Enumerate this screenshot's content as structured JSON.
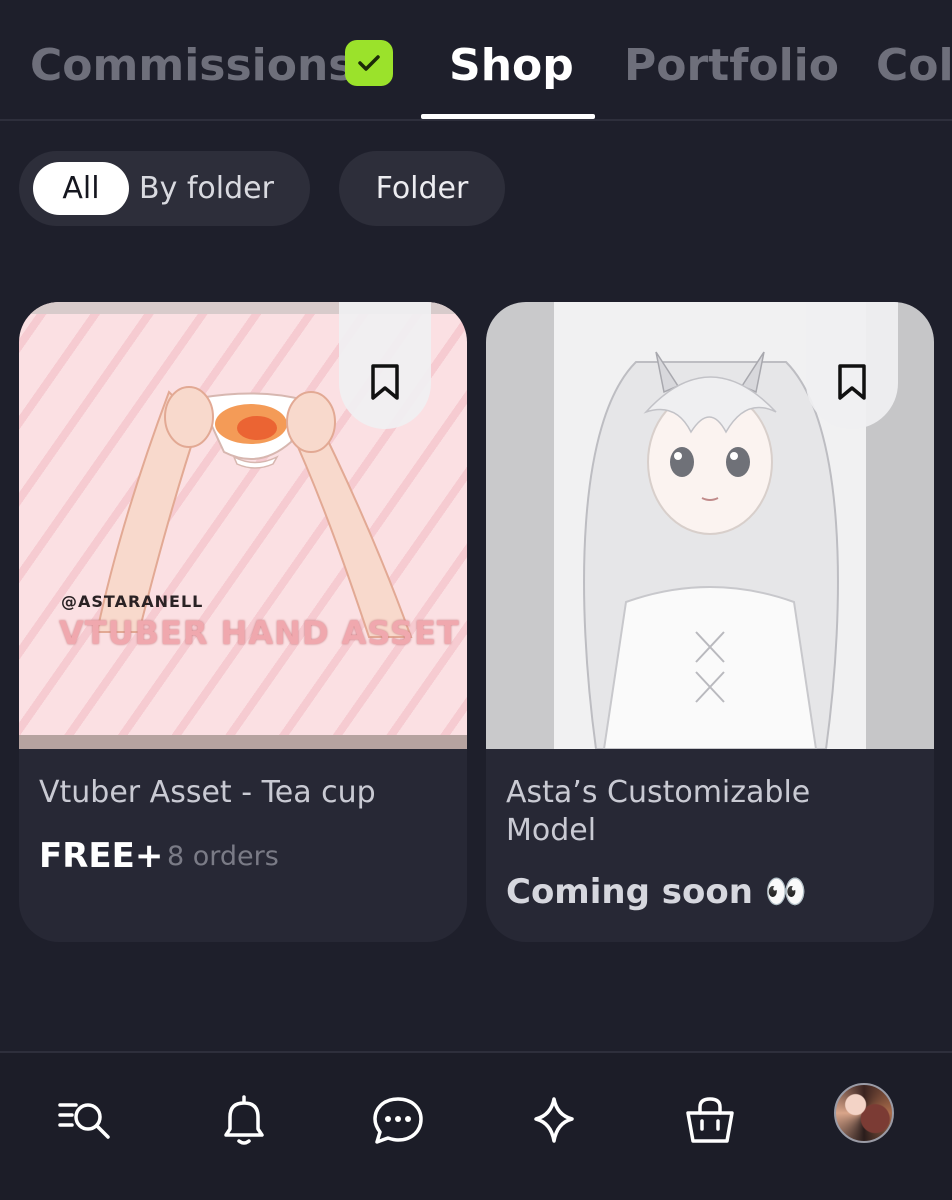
{
  "tabs": [
    {
      "label": "Commissions"
    },
    {
      "label": "Shop"
    },
    {
      "label": "Portfolio"
    },
    {
      "label": "Col"
    }
  ],
  "filters": {
    "all": "All",
    "by_folder": "By folder",
    "folder": "Folder"
  },
  "cards": [
    {
      "title": "Vtuber Asset - Tea cup",
      "price": "FREE+",
      "orders": "8 orders",
      "watermark_handle": "@ASTARANELL",
      "watermark_title": "VTUBER HAND ASSET"
    },
    {
      "title": "Asta’s Customizable Model",
      "status": "Coming soon 👀"
    }
  ],
  "nav": [
    "search-list-icon",
    "bell-icon",
    "chat-icon",
    "sparkle-icon",
    "bag-icon",
    "avatar"
  ],
  "colors": {
    "background": "#1e1f2b",
    "card": "#272835",
    "chip": "#2d2e3a",
    "accent_check": "#9be22b",
    "muted_text": "#6e6f7b"
  }
}
